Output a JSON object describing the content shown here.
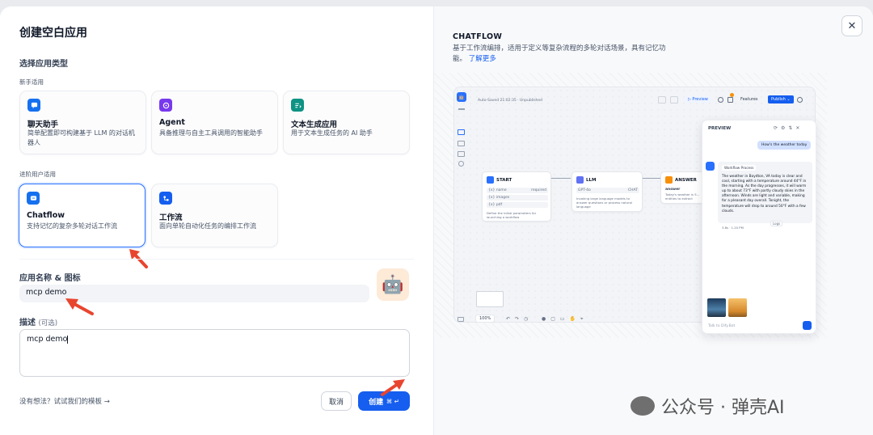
{
  "dialog": {
    "title": "创建空白应用",
    "section_app_type": "选择应用类型",
    "group_beginner": "新手适用",
    "group_advanced": "进阶用户适用",
    "beginner_cards": [
      {
        "title": "聊天助手",
        "desc": "简单配置即可构建基于 LLM 的对话机器人",
        "icon": "chat-bubble-icon",
        "color": "#1570ef"
      },
      {
        "title": "Agent",
        "desc": "具备推理与自主工具调用的智能助手",
        "icon": "agent-robot-icon",
        "color": "#7839ee"
      },
      {
        "title": "文本生成应用",
        "desc": "用于文本生成任务的 AI 助手",
        "icon": "text-generate-icon",
        "color": "#0e9384"
      }
    ],
    "advanced_cards": [
      {
        "title": "Chatflow",
        "desc": "支持记忆的复杂多轮对话工作流",
        "icon": "chatflow-icon",
        "color": "#1570ef"
      },
      {
        "title": "工作流",
        "desc": "面向单轮自动化任务的编排工作流",
        "icon": "workflow-icon",
        "color": "#155eef"
      }
    ],
    "name_label": "应用名称 & 图标",
    "name_value": "mcp demo",
    "desc_label": "描述",
    "desc_optional": "(可选)",
    "desc_value": "mcp demo",
    "template_link": "没有想法？试试我们的模板 →",
    "cancel_label": "取消",
    "create_label": "创建",
    "create_shortcut": "⌘ ↵"
  },
  "preview": {
    "title": "CHATFLOW",
    "desc": "基于工作流编排，适用于定义等复杂流程的多轮对话场景，具有记忆功能。",
    "learn_more": "了解更多",
    "canvas": {
      "autosave": "Auto-Saved 21:02:35 · Unpublished",
      "preview_btn": "▷ Preview",
      "features_btn": "Features",
      "publish_btn": "Publish ⌄",
      "start_node": "START",
      "start_vars": [
        "{x} name",
        "{x} images",
        "{x} pdf"
      ],
      "start_required": "required",
      "start_desc": "Define the initial parameters for launching a workflow",
      "llm_node": "LLM",
      "llm_model": "GPT-4o",
      "llm_mode": "CHAT",
      "llm_desc": "Invoking large language models to answer questions or process natural language",
      "answer_node": "ANSWER",
      "answer_label": "answer",
      "answer_desc": "Today's weather is 5... entities to extract",
      "zoom": "100%",
      "panel_title": "PREVIEW",
      "user_msg": "How's the weather today",
      "workflow_process": "Workflow Process",
      "bot_msg": "The weather in Boydton, VA today is clear and cool, starting with a temperature around 44°F in the morning. As the day progresses, it will warm up to about 73°F with partly cloudy skies in the afternoon. Winds are light and variable, making for a pleasant day overall. Tonight, the temperature will drop to around 50°F with a few clouds.",
      "msg_meta": "3.8s · 1.20 PM",
      "logs_btn": "Logs",
      "input_placeholder": "Talk to Dify.Bot"
    }
  },
  "watermark": {
    "text": "公众号 · 弹壳AI"
  }
}
